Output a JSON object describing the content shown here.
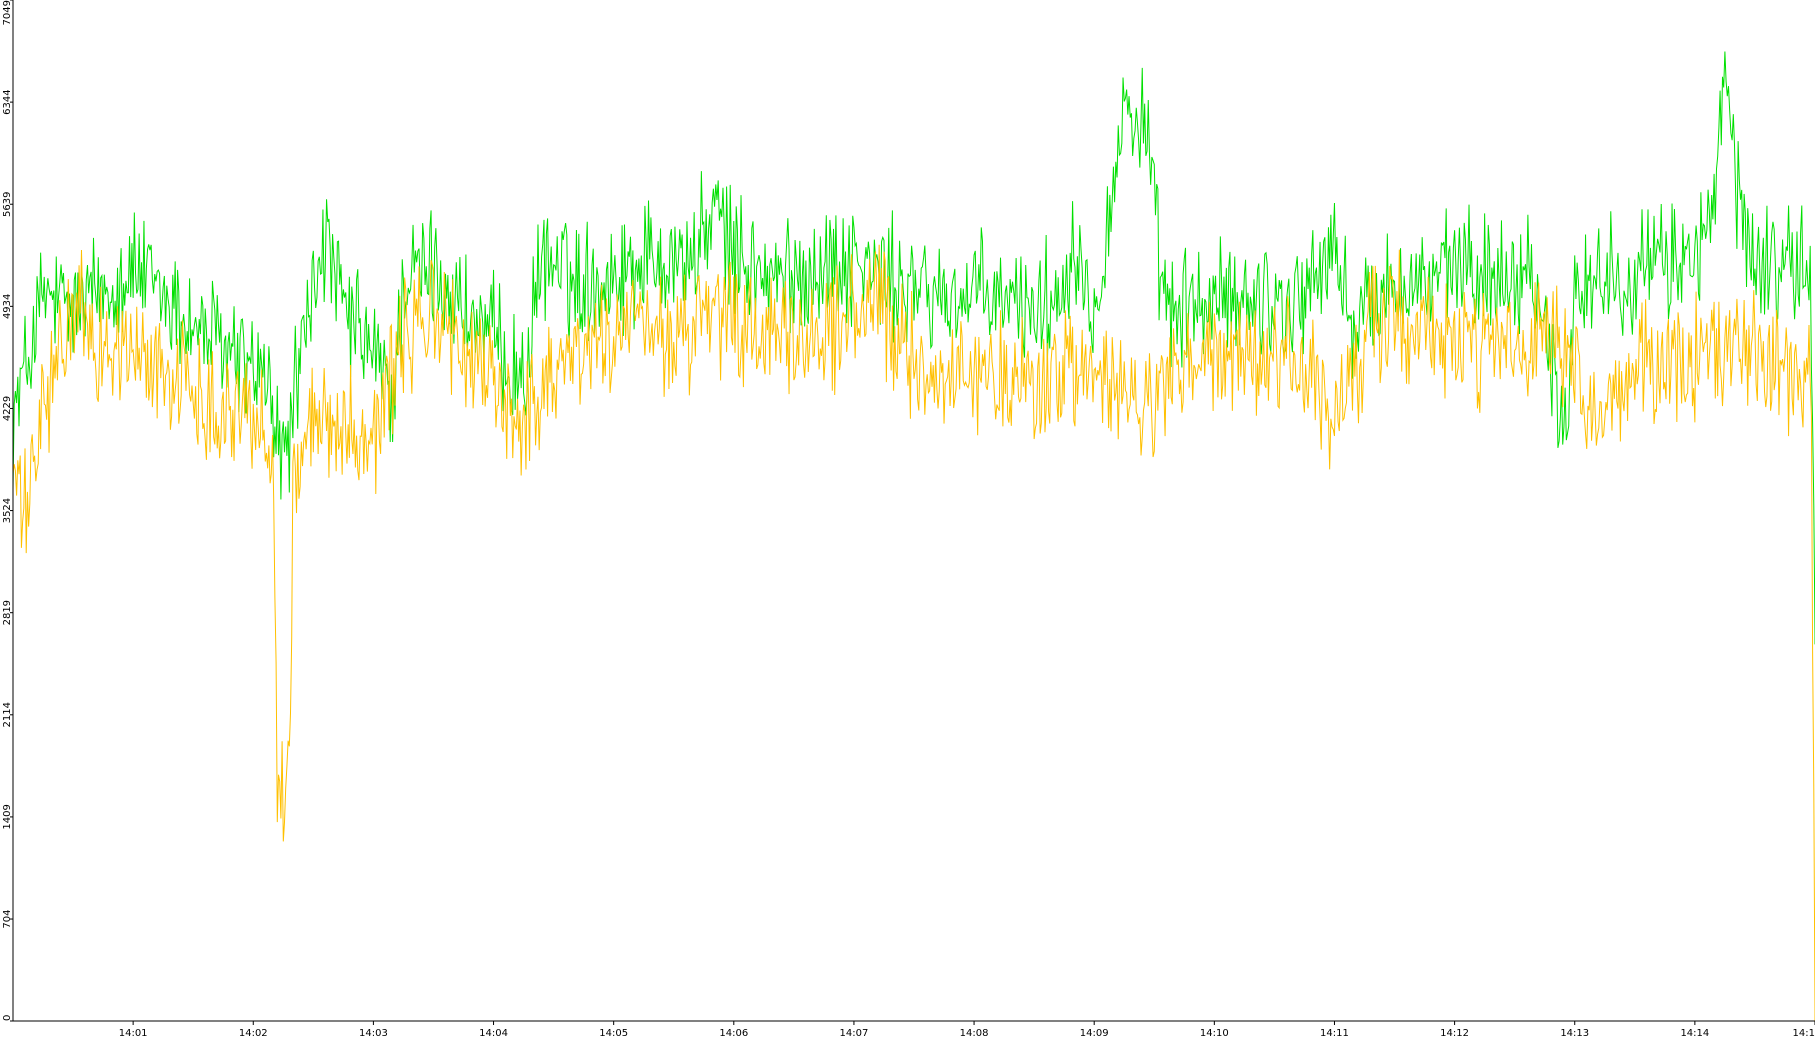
{
  "chart_data": {
    "type": "line",
    "title": "",
    "xlabel": "",
    "ylabel": "",
    "y_ticks": [
      "0",
      "704",
      "1409",
      "2114",
      "2819",
      "3524",
      "4229",
      "4934",
      "5639",
      "6344",
      "7049"
    ],
    "ylim": [
      0,
      7049
    ],
    "x_ticks": [
      "14:01",
      "14:02",
      "14:03",
      "14:04",
      "14:05",
      "14:06",
      "14:07",
      "14:08",
      "14:09",
      "14:10",
      "14:11",
      "14:12",
      "14:13",
      "14:14",
      "14:1"
    ],
    "grid": false,
    "legend": "none",
    "x_range": [
      "14:00:00",
      "14:15:00"
    ],
    "series": [
      {
        "color": "#00e000",
        "points": [
          [
            "14:00:00",
            4150
          ],
          [
            "14:00:15",
            5000
          ],
          [
            "14:00:30",
            4900
          ],
          [
            "14:00:45",
            5050
          ],
          [
            "14:01:00",
            5200
          ],
          [
            "14:01:15",
            5000
          ],
          [
            "14:01:30",
            4800
          ],
          [
            "14:01:45",
            4650
          ],
          [
            "14:02:00",
            4500
          ],
          [
            "14:02:08",
            4350
          ],
          [
            "14:02:15",
            3800
          ],
          [
            "14:02:20",
            4300
          ],
          [
            "14:02:35",
            5400
          ],
          [
            "14:02:45",
            4900
          ],
          [
            "14:03:00",
            4600
          ],
          [
            "14:03:10",
            4300
          ],
          [
            "14:03:15",
            5100
          ],
          [
            "14:03:30",
            5200
          ],
          [
            "14:03:45",
            4900
          ],
          [
            "14:04:00",
            4700
          ],
          [
            "14:04:15",
            4400
          ],
          [
            "14:04:25",
            5300
          ],
          [
            "14:04:40",
            5100
          ],
          [
            "14:05:00",
            5150
          ],
          [
            "14:05:20",
            5300
          ],
          [
            "14:05:40",
            5250
          ],
          [
            "14:05:50",
            5600
          ],
          [
            "14:06:00",
            5300
          ],
          [
            "14:06:20",
            5100
          ],
          [
            "14:06:40",
            5200
          ],
          [
            "14:07:00",
            5250
          ],
          [
            "14:07:20",
            5100
          ],
          [
            "14:07:40",
            5000
          ],
          [
            "14:08:00",
            5000
          ],
          [
            "14:08:20",
            4950
          ],
          [
            "14:08:40",
            4950
          ],
          [
            "14:08:50",
            5400
          ],
          [
            "14:09:00",
            4900
          ],
          [
            "14:09:15",
            6300
          ],
          [
            "14:09:25",
            6200
          ],
          [
            "14:09:35",
            4900
          ],
          [
            "14:10:00",
            4950
          ],
          [
            "14:10:20",
            5000
          ],
          [
            "14:10:40",
            4950
          ],
          [
            "14:11:00",
            5300
          ],
          [
            "14:11:10",
            4800
          ],
          [
            "14:11:30",
            5100
          ],
          [
            "14:11:50",
            5100
          ],
          [
            "14:12:00",
            5200
          ],
          [
            "14:12:20",
            5150
          ],
          [
            "14:12:40",
            5200
          ],
          [
            "14:12:55",
            4000
          ],
          [
            "14:13:00",
            5100
          ],
          [
            "14:13:20",
            5150
          ],
          [
            "14:13:40",
            5200
          ],
          [
            "14:14:00",
            5300
          ],
          [
            "14:14:10",
            5600
          ],
          [
            "14:14:15",
            6600
          ],
          [
            "14:14:20",
            5800
          ],
          [
            "14:14:30",
            5200
          ],
          [
            "14:14:45",
            5250
          ],
          [
            "14:14:58",
            5150
          ],
          [
            "14:15:00",
            2600
          ]
        ]
      },
      {
        "color": "#ffc000",
        "points": [
          [
            "14:00:00",
            3900
          ],
          [
            "14:00:05",
            3400
          ],
          [
            "14:00:15",
            4200
          ],
          [
            "14:00:30",
            4900
          ],
          [
            "14:00:45",
            4650
          ],
          [
            "14:01:00",
            4600
          ],
          [
            "14:01:15",
            4500
          ],
          [
            "14:01:30",
            4350
          ],
          [
            "14:01:45",
            4250
          ],
          [
            "14:02:00",
            4200
          ],
          [
            "14:02:10",
            3900
          ],
          [
            "14:02:12",
            1750
          ],
          [
            "14:02:15",
            1550
          ],
          [
            "14:02:18",
            1700
          ],
          [
            "14:02:20",
            3800
          ],
          [
            "14:02:35",
            4200
          ],
          [
            "14:02:50",
            4100
          ],
          [
            "14:03:00",
            4050
          ],
          [
            "14:03:15",
            4700
          ],
          [
            "14:03:30",
            4900
          ],
          [
            "14:03:45",
            4600
          ],
          [
            "14:04:00",
            4400
          ],
          [
            "14:04:15",
            4100
          ],
          [
            "14:04:30",
            4550
          ],
          [
            "14:04:50",
            4650
          ],
          [
            "14:05:10",
            4800
          ],
          [
            "14:05:30",
            4700
          ],
          [
            "14:05:50",
            4850
          ],
          [
            "14:06:10",
            4750
          ],
          [
            "14:06:30",
            4650
          ],
          [
            "14:06:50",
            4800
          ],
          [
            "14:07:10",
            4950
          ],
          [
            "14:07:30",
            4550
          ],
          [
            "14:07:50",
            4450
          ],
          [
            "14:08:10",
            4450
          ],
          [
            "14:08:30",
            4400
          ],
          [
            "14:08:50",
            4500
          ],
          [
            "14:09:10",
            4350
          ],
          [
            "14:09:25",
            4200
          ],
          [
            "14:09:40",
            4450
          ],
          [
            "14:10:00",
            4600
          ],
          [
            "14:10:20",
            4500
          ],
          [
            "14:10:40",
            4600
          ],
          [
            "14:11:00",
            4100
          ],
          [
            "14:11:15",
            4700
          ],
          [
            "14:11:30",
            4900
          ],
          [
            "14:11:50",
            4700
          ],
          [
            "14:12:10",
            4650
          ],
          [
            "14:12:30",
            4600
          ],
          [
            "14:12:50",
            4700
          ],
          [
            "14:13:10",
            4050
          ],
          [
            "14:13:30",
            4550
          ],
          [
            "14:13:50",
            4500
          ],
          [
            "14:14:10",
            4600
          ],
          [
            "14:14:30",
            4700
          ],
          [
            "14:14:45",
            4500
          ],
          [
            "14:14:58",
            4400
          ],
          [
            "14:15:00",
            0
          ]
        ]
      }
    ]
  }
}
